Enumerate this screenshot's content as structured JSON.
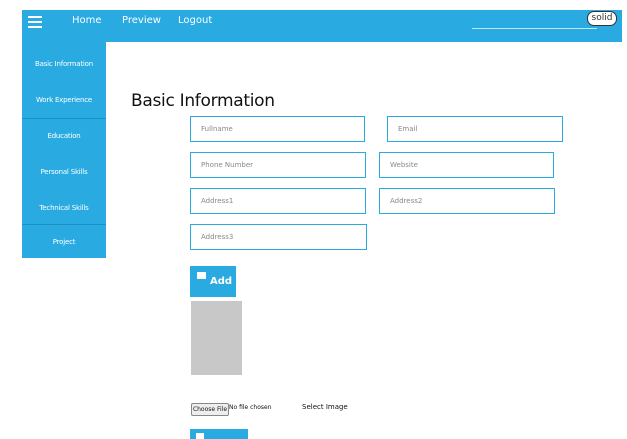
{
  "topbar": {
    "nav": [
      "Home",
      "Preview",
      "Logout"
    ],
    "user_button": "solid"
  },
  "sidebar": {
    "items": [
      {
        "label": "Basic Information"
      },
      {
        "label": "Work Experience"
      },
      {
        "label": "Education"
      },
      {
        "label": "Personal Skills"
      },
      {
        "label": "Technical Skills"
      },
      {
        "label": "Project"
      }
    ]
  },
  "main": {
    "title": "Basic Information",
    "fields": {
      "fullname": "Fullname",
      "email": "Email",
      "phone": "Phone Number",
      "website": "Website",
      "address1": "Address1",
      "address2": "Address2",
      "address3": "Address3"
    },
    "add_label": "Add",
    "file": {
      "button": "Choose File",
      "status": "No file chosen",
      "label": "Select Image"
    }
  },
  "colors": {
    "accent": "#29abe2",
    "placeholder": "#c8c8c8"
  },
  "icons": {
    "menu": "hamburger-icon",
    "add": "envelope-icon"
  }
}
